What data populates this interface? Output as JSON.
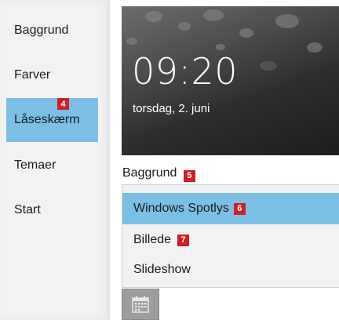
{
  "sidebar": {
    "items": [
      {
        "label": "Baggrund",
        "selected": false
      },
      {
        "label": "Farver",
        "selected": false
      },
      {
        "label": "Låseskærm",
        "selected": true,
        "badge": "4"
      },
      {
        "label": "Temaer",
        "selected": false
      },
      {
        "label": "Start",
        "selected": false
      }
    ]
  },
  "preview": {
    "time": "09:20",
    "date": "torsdag, 2. juni"
  },
  "background": {
    "label": "Baggrund",
    "label_badge": "5",
    "options": [
      {
        "label": "Windows Spotlys",
        "selected": true,
        "badge": "6"
      },
      {
        "label": "Billede",
        "selected": false,
        "badge": "7"
      },
      {
        "label": "Slideshow",
        "selected": false
      }
    ]
  },
  "colors": {
    "selection": "#7bbfe4",
    "badge": "#cf1f24"
  },
  "icons": {
    "calendar_button": "calendar-icon"
  }
}
